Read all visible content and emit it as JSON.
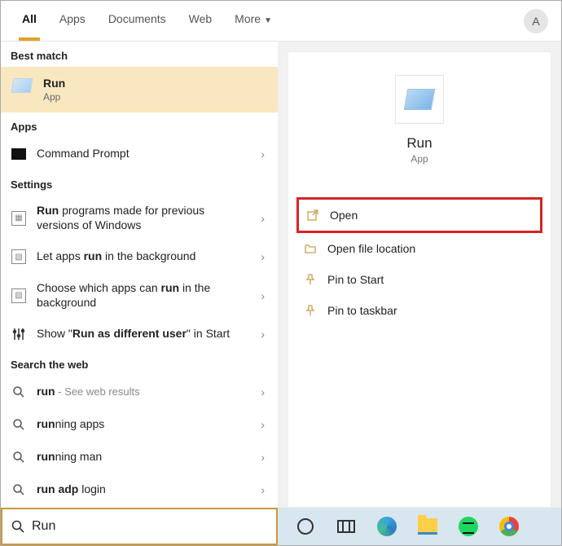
{
  "tabs": {
    "all": "All",
    "apps": "Apps",
    "documents": "Documents",
    "web": "Web",
    "more": "More"
  },
  "avatar_initial": "A",
  "sections": {
    "best": "Best match",
    "apps": "Apps",
    "settings": "Settings",
    "web": "Search the web"
  },
  "best_match": {
    "title": "Run",
    "subtitle": "App"
  },
  "apps_list": {
    "cmd": "Command Prompt"
  },
  "settings_list": {
    "s1_pre": "Run",
    "s1_post": " programs made for previous versions of Windows",
    "s2_pre": "Let apps ",
    "s2_b": "run",
    "s2_post": " in the background",
    "s3_pre": "Choose which apps can ",
    "s3_b": "run",
    "s3_post": " in the background",
    "s4_pre": "Show \"",
    "s4_b": "Run as different user",
    "s4_post": "\" in Start"
  },
  "web_list": {
    "w1_b": "run",
    "w1_dim": " - See web results",
    "w2_b": "run",
    "w2_post": "ning apps",
    "w3_b": "run",
    "w3_post": "ning man",
    "w4_b": "run adp",
    "w4_post": " login"
  },
  "hero": {
    "title": "Run",
    "subtitle": "App"
  },
  "actions": {
    "open": "Open",
    "loc": "Open file location",
    "pin_start": "Pin to Start",
    "pin_task": "Pin to taskbar"
  },
  "search_value": "Run"
}
